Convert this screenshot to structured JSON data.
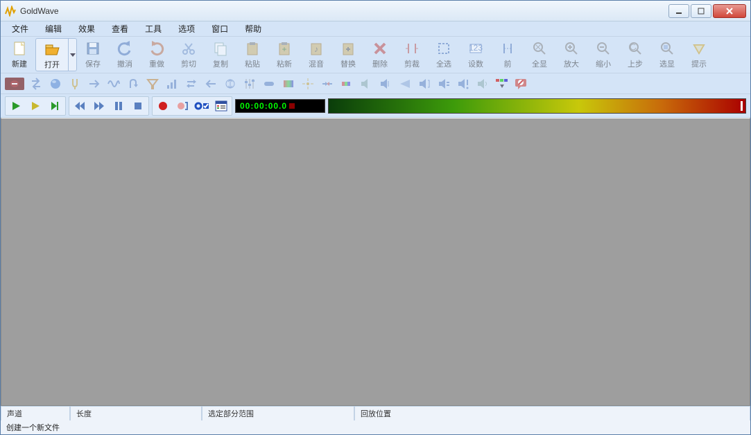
{
  "window": {
    "title": "GoldWave"
  },
  "menu": {
    "file": "文件",
    "edit": "编辑",
    "effect": "效果",
    "view": "查看",
    "tool": "工具",
    "option": "选项",
    "window": "窗口",
    "help": "帮助"
  },
  "toolbar": {
    "new": "新建",
    "open": "打开",
    "save": "保存",
    "undo": "撤消",
    "redo": "重做",
    "cut": "剪切",
    "copy": "复制",
    "paste": "粘贴",
    "paste_new": "粘新",
    "mix": "混音",
    "replace": "替换",
    "delete": "删除",
    "trim": "剪裁",
    "sel_all": "全选",
    "set": "设数",
    "prev": "前",
    "all_view": "全显",
    "zoom_in": "放大",
    "zoom_out": "缩小",
    "step_back": "上步",
    "sel_view": "选显",
    "hint": "提示"
  },
  "transport": {
    "timer": "00:00:00.0"
  },
  "status": {
    "channel_label": "声道",
    "length_label": "长度",
    "selection_label": "选定部分范围",
    "position_label": "回放位置",
    "hint": "创建一个新文件"
  }
}
